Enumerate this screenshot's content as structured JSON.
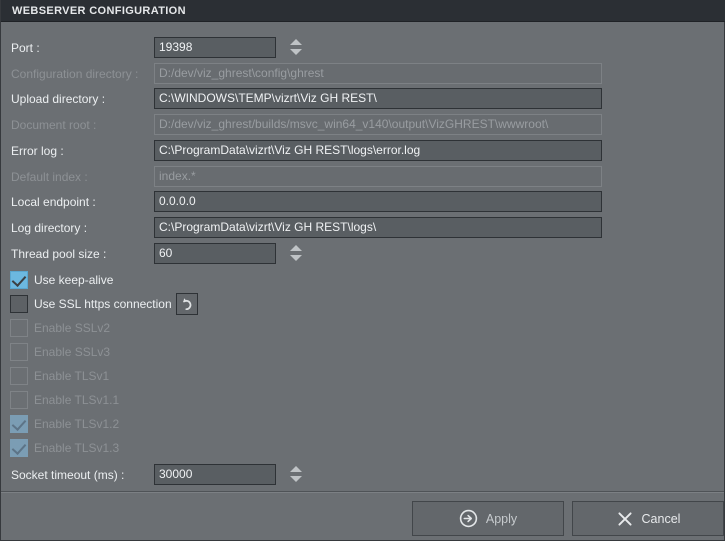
{
  "window": {
    "title": "WEBSERVER CONFIGURATION"
  },
  "colors": {
    "titlebar_bg": "#2b2f34",
    "body_bg": "#6b6f73",
    "field_bg": "#595e62",
    "field_border": "#2e3236",
    "checkbox_checked": "#6cb8e0",
    "checkbox_checked_disabled": "#7b9db4",
    "text": "#eceff1",
    "text_disabled": "#8d9195",
    "button_bg": "#63676b"
  },
  "fields": [
    {
      "label": "Port :",
      "value": "19398",
      "size": "small",
      "disabled": false,
      "spinner": true
    },
    {
      "label": "Configuration directory :",
      "value": "D:/dev/viz_ghrest\\config\\ghrest",
      "size": "wide",
      "disabled": true,
      "spinner": false
    },
    {
      "label": "Upload directory :",
      "value": "C:\\WINDOWS\\TEMP\\vizrt\\Viz GH REST\\",
      "size": "wide",
      "disabled": false,
      "spinner": false
    },
    {
      "label": "Document root :",
      "value": "D:/dev/viz_ghrest/builds/msvc_win64_v140\\output\\VizGHREST\\wwwroot\\",
      "size": "wide",
      "disabled": true,
      "spinner": false
    },
    {
      "label": "Error log :",
      "value": "C:\\ProgramData\\vizrt\\Viz GH REST\\logs\\error.log",
      "size": "wide",
      "disabled": false,
      "spinner": false
    },
    {
      "label": "Default index :",
      "value": "index.*",
      "size": "wide",
      "disabled": true,
      "spinner": false
    },
    {
      "label": "Local endpoint :",
      "value": "0.0.0.0",
      "size": "wide",
      "disabled": false,
      "spinner": false
    },
    {
      "label": "Log directory :",
      "value": "C:\\ProgramData\\vizrt\\Viz GH REST\\logs\\",
      "size": "wide",
      "disabled": false,
      "spinner": false
    },
    {
      "label": "Thread pool size :",
      "value": "60",
      "size": "small",
      "disabled": false,
      "spinner": true
    }
  ],
  "checkboxes": [
    {
      "label": "Use keep-alive",
      "checked": true,
      "disabled": false
    },
    {
      "label": "Use SSL https connection",
      "checked": false,
      "disabled": false
    },
    {
      "label": "Enable SSLv2",
      "checked": false,
      "disabled": true
    },
    {
      "label": "Enable SSLv3",
      "checked": false,
      "disabled": true
    },
    {
      "label": "Enable TLSv1",
      "checked": false,
      "disabled": true
    },
    {
      "label": "Enable TLSv1.1",
      "checked": false,
      "disabled": true
    },
    {
      "label": "Enable TLSv1.2",
      "checked": true,
      "disabled": true
    },
    {
      "label": "Enable TLSv1.3",
      "checked": true,
      "disabled": true
    }
  ],
  "socket_timeout": {
    "label": "Socket timeout (ms) :",
    "value": "30000",
    "size": "small",
    "disabled": false,
    "spinner": true
  },
  "revert_button": {
    "icon": "undo-arrow-icon"
  },
  "footer": {
    "apply_label": "Apply",
    "apply_icon": "arrow-right-circle-icon",
    "cancel_label": "Cancel",
    "cancel_icon": "close-x-icon"
  }
}
